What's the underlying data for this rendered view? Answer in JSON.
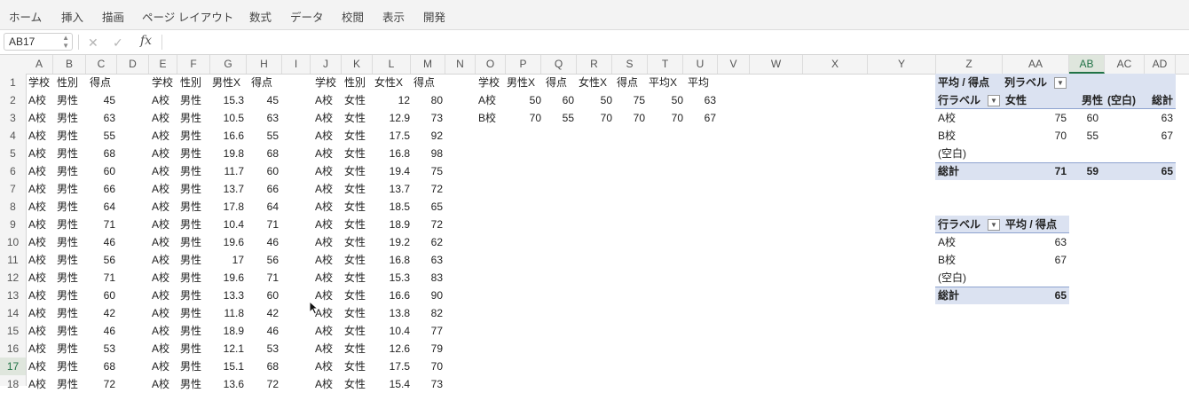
{
  "ribbon": {
    "tabs": [
      "ホーム",
      "挿入",
      "描画",
      "ページ レイアウト",
      "数式",
      "データ",
      "校閲",
      "表示",
      "開発"
    ]
  },
  "formula_bar": {
    "name_box": "AB17",
    "fx_label": "fx",
    "content": ""
  },
  "columns": [
    "A",
    "B",
    "C",
    "D",
    "E",
    "F",
    "G",
    "H",
    "I",
    "J",
    "K",
    "L",
    "M",
    "N",
    "O",
    "P",
    "Q",
    "R",
    "S",
    "T",
    "U",
    "V",
    "W",
    "X",
    "Y",
    "Z",
    "AA",
    "AB",
    "AC",
    "AD"
  ],
  "selected_column": "AB",
  "rows": [
    "1",
    "2",
    "3",
    "4",
    "5",
    "6",
    "7",
    "8",
    "9",
    "10",
    "11",
    "12",
    "13",
    "14",
    "15",
    "16",
    "17",
    "18"
  ],
  "selected_row": "17",
  "headers": {
    "t1": [
      "学校",
      "性別",
      "得点"
    ],
    "t2": [
      "学校",
      "性別",
      "男性X",
      "得点"
    ],
    "t3": [
      "学校",
      "性別",
      "女性X",
      "得点"
    ],
    "summary": [
      "学校",
      "男性X",
      "得点",
      "女性X",
      "得点",
      "平均X",
      "平均"
    ]
  },
  "table1": [
    [
      "A校",
      "男性",
      "45"
    ],
    [
      "A校",
      "男性",
      "63"
    ],
    [
      "A校",
      "男性",
      "55"
    ],
    [
      "A校",
      "男性",
      "68"
    ],
    [
      "A校",
      "男性",
      "60"
    ],
    [
      "A校",
      "男性",
      "66"
    ],
    [
      "A校",
      "男性",
      "64"
    ],
    [
      "A校",
      "男性",
      "71"
    ],
    [
      "A校",
      "男性",
      "46"
    ],
    [
      "A校",
      "男性",
      "56"
    ],
    [
      "A校",
      "男性",
      "71"
    ],
    [
      "A校",
      "男性",
      "60"
    ],
    [
      "A校",
      "男性",
      "42"
    ],
    [
      "A校",
      "男性",
      "46"
    ],
    [
      "A校",
      "男性",
      "53"
    ],
    [
      "A校",
      "男性",
      "68"
    ],
    [
      "A校",
      "男性",
      "72"
    ]
  ],
  "table2": [
    [
      "A校",
      "男性",
      "15.3",
      "45"
    ],
    [
      "A校",
      "男性",
      "10.5",
      "63"
    ],
    [
      "A校",
      "男性",
      "16.6",
      "55"
    ],
    [
      "A校",
      "男性",
      "19.8",
      "68"
    ],
    [
      "A校",
      "男性",
      "11.7",
      "60"
    ],
    [
      "A校",
      "男性",
      "13.7",
      "66"
    ],
    [
      "A校",
      "男性",
      "17.8",
      "64"
    ],
    [
      "A校",
      "男性",
      "10.4",
      "71"
    ],
    [
      "A校",
      "男性",
      "19.6",
      "46"
    ],
    [
      "A校",
      "男性",
      "17",
      "56"
    ],
    [
      "A校",
      "男性",
      "19.6",
      "71"
    ],
    [
      "A校",
      "男性",
      "13.3",
      "60"
    ],
    [
      "A校",
      "男性",
      "11.8",
      "42"
    ],
    [
      "A校",
      "男性",
      "18.9",
      "46"
    ],
    [
      "A校",
      "男性",
      "12.1",
      "53"
    ],
    [
      "A校",
      "男性",
      "15.1",
      "68"
    ],
    [
      "A校",
      "男性",
      "13.6",
      "72"
    ]
  ],
  "table3": [
    [
      "A校",
      "女性",
      "12",
      "80"
    ],
    [
      "A校",
      "女性",
      "12.9",
      "73"
    ],
    [
      "A校",
      "女性",
      "17.5",
      "92"
    ],
    [
      "A校",
      "女性",
      "16.8",
      "98"
    ],
    [
      "A校",
      "女性",
      "19.4",
      "75"
    ],
    [
      "A校",
      "女性",
      "13.7",
      "72"
    ],
    [
      "A校",
      "女性",
      "18.5",
      "65"
    ],
    [
      "A校",
      "女性",
      "18.9",
      "72"
    ],
    [
      "A校",
      "女性",
      "19.2",
      "62"
    ],
    [
      "A校",
      "女性",
      "16.8",
      "63"
    ],
    [
      "A校",
      "女性",
      "15.3",
      "83"
    ],
    [
      "A校",
      "女性",
      "16.6",
      "90"
    ],
    [
      "A校",
      "女性",
      "13.8",
      "82"
    ],
    [
      "A校",
      "女性",
      "10.4",
      "77"
    ],
    [
      "A校",
      "女性",
      "12.6",
      "79"
    ],
    [
      "A校",
      "女性",
      "17.5",
      "70"
    ],
    [
      "A校",
      "女性",
      "15.4",
      "73"
    ]
  ],
  "summary": [
    [
      "A校",
      "50",
      "60",
      "50",
      "75",
      "50",
      "63"
    ],
    [
      "B校",
      "70",
      "55",
      "70",
      "70",
      "70",
      "67"
    ]
  ],
  "pivot1": {
    "value_label": "平均 / 得点",
    "col_label": "列ラベル",
    "row_label": "行ラベル",
    "col_headers": [
      "女性",
      "男性",
      "(空白)",
      "総計"
    ],
    "rows": [
      {
        "label": "A校",
        "values": [
          "75",
          "60",
          "",
          "63"
        ]
      },
      {
        "label": "B校",
        "values": [
          "70",
          "55",
          "",
          "67"
        ]
      },
      {
        "label": "(空白)",
        "values": [
          "",
          "",
          "",
          ""
        ]
      }
    ],
    "total": {
      "label": "総計",
      "values": [
        "71",
        "59",
        "",
        "65"
      ]
    }
  },
  "pivot2": {
    "row_label": "行ラベル",
    "value_label": "平均 / 得点",
    "rows": [
      {
        "label": "A校",
        "value": "63"
      },
      {
        "label": "B校",
        "value": "67"
      },
      {
        "label": "(空白)",
        "value": ""
      }
    ],
    "total": {
      "label": "総計",
      "value": "65"
    }
  },
  "colors": {
    "pivot_header": "#dbe2f1",
    "selection": "#217346"
  }
}
